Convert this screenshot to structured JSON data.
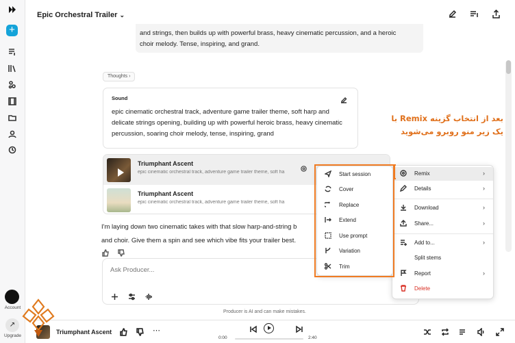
{
  "app": {
    "project_title": "Epic Orchestral Trailer"
  },
  "rail": {
    "account_label": "Account",
    "upgrade_label": "Upgrade"
  },
  "prompt": {
    "line1": "and strings, then builds up with powerful brass, heavy cinematic percussion, and a heroic",
    "line2": "choir melody. Tense, inspiring, and grand."
  },
  "thoughts_label": "Thoughts",
  "sound_card": {
    "title": "Sound",
    "text": "epic cinematic orchestral track, adventure game trailer theme, soft harp and delicate strings opening, building up with powerful heroic brass, heavy cinematic percussion, soaring choir melody, tense, inspiring, grand"
  },
  "tracks": [
    {
      "name": "Triumphant Ascent",
      "desc": "epic cinematic orchestral track, adventure game trailer theme, soft ha"
    },
    {
      "name": "Triumphant Ascent",
      "desc": "epic cinematic orchestral track, adventure game trailer theme, soft ha"
    }
  ],
  "reply": {
    "line1": "I'm laying down two cinematic takes with that slow harp-and-string b",
    "line2": "and choir. Give them a spin and see which vibe fits your trailer best."
  },
  "composer": {
    "placeholder": "Ask Producer..."
  },
  "disclaimer": "Producer is AI and can make mistakes.",
  "player": {
    "title": "Triumphant Ascent",
    "time_current": "0:00",
    "time_total": "2:40",
    "progress": 0
  },
  "main_menu": [
    {
      "label": "Remix",
      "icon": "remix-icon",
      "submenu": true
    },
    {
      "label": "Details",
      "icon": "pencil-icon",
      "submenu": true
    },
    {
      "label": "Download",
      "icon": "download-icon",
      "submenu": true
    },
    {
      "label": "Share...",
      "icon": "share-icon",
      "submenu": true
    },
    {
      "label": "Add to...",
      "icon": "add-icon",
      "submenu": true
    },
    {
      "label": "Split stems",
      "icon": "stems-icon",
      "submenu": false
    },
    {
      "label": "Report",
      "icon": "flag-icon",
      "submenu": true
    },
    {
      "label": "Delete",
      "icon": "trash-icon",
      "submenu": false
    }
  ],
  "remix_submenu": [
    {
      "label": "Start session",
      "icon": "send-icon"
    },
    {
      "label": "Cover",
      "icon": "cover-icon"
    },
    {
      "label": "Replace",
      "icon": "replace-icon"
    },
    {
      "label": "Extend",
      "icon": "extend-icon"
    },
    {
      "label": "Use prompt",
      "icon": "prompt-icon"
    },
    {
      "label": "Variation",
      "icon": "variation-icon"
    },
    {
      "label": "Trim",
      "icon": "scissors-icon"
    }
  ],
  "annotation": {
    "line1": "بعد از انتخاب گزینه Remix با",
    "line2": "یک زیر منو روبرو می‌شوید"
  },
  "colors": {
    "accent": "#14a3d9",
    "highlight": "#f07b22",
    "danger": "#d93025",
    "annotation": "#e0701b"
  }
}
